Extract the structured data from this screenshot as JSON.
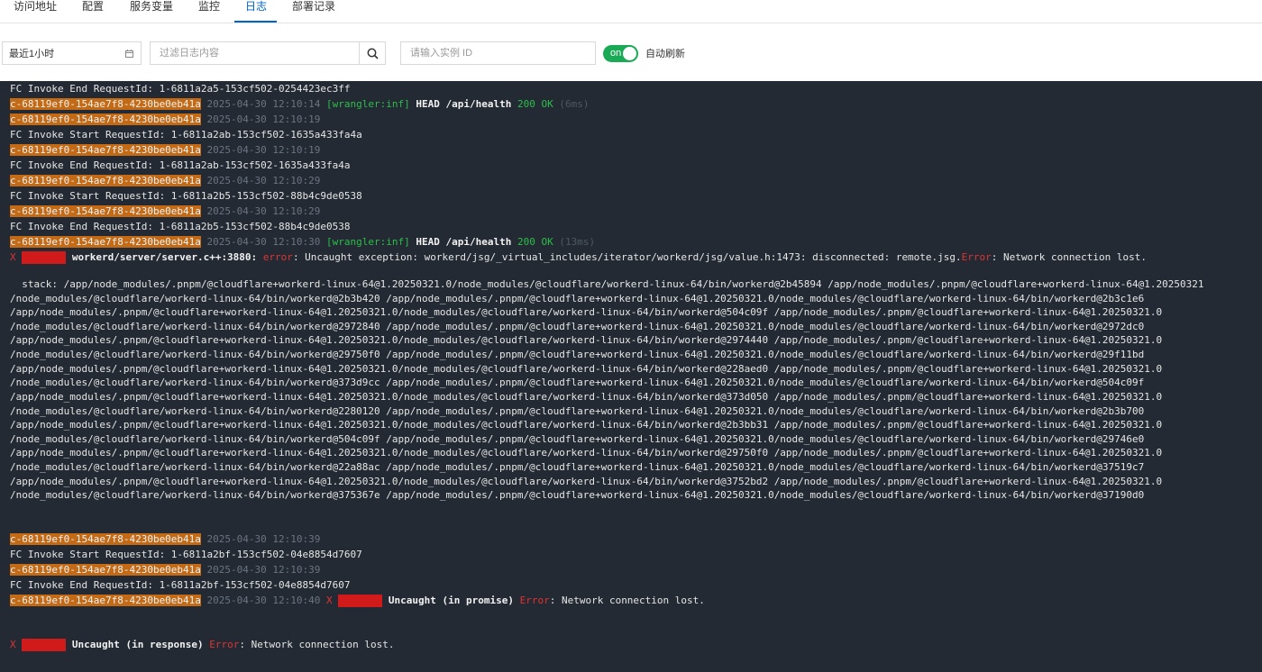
{
  "tabs": [
    {
      "label": "访问地址"
    },
    {
      "label": "配置"
    },
    {
      "label": "服务变量"
    },
    {
      "label": "监控"
    },
    {
      "label": "日志",
      "active": true
    },
    {
      "label": "部署记录"
    }
  ],
  "toolbar": {
    "time_range": "最近1小时",
    "filter_placeholder": "过滤日志内容",
    "instance_placeholder": "请输入实例 ID",
    "auto_refresh_toggle": "on",
    "auto_refresh_label": "自动刷新"
  },
  "colors": {
    "accent": "#0064c8",
    "toggle_on": "#1aaa55",
    "log_bg": "#232a33",
    "instance_highlight": "#c26a16",
    "error": "#e03333"
  },
  "log": {
    "instance_id": "c-68119ef0-154ae7f8-4230be0eb41a",
    "x_mark": "X",
    "entries": {
      "l0": "FC Invoke End RequestId: 1-6811a2a5-153cf502-0254423ec3ff",
      "l1": {
        "ts": "2025-04-30 12:10:14",
        "tag": "[wrangler:inf]",
        "req": "HEAD /api/health",
        "status": "200 OK",
        "dur": "(6ms)"
      },
      "l2": {
        "ts": "2025-04-30 12:10:19"
      },
      "l3": "FC Invoke Start RequestId: 1-6811a2ab-153cf502-1635a433fa4a",
      "l4": {
        "ts": "2025-04-30 12:10:19"
      },
      "l5": "FC Invoke End RequestId: 1-6811a2ab-153cf502-1635a433fa4a",
      "l6": {
        "ts": "2025-04-30 12:10:29"
      },
      "l7": "FC Invoke Start RequestId: 1-6811a2b5-153cf502-88b4c9de0538",
      "l8": {
        "ts": "2025-04-30 12:10:29"
      },
      "l9": "FC Invoke End RequestId: 1-6811a2b5-153cf502-88b4c9de0538",
      "l10": {
        "ts": "2025-04-30 12:10:30",
        "tag": "[wrangler:inf]",
        "req": "HEAD /api/health",
        "status": "200 OK",
        "dur": "(13ms)"
      },
      "l11": {
        "source": "workerd/server/server.c++:3880:",
        "err_word": "error",
        "msg1": ": Uncaught exception: workerd/jsg/_virtual_includes/iterator/workerd/jsg/value.h:1473: disconnected: remote.jsg.",
        "err_word2": "Error",
        "msg2": ": Network connection lost."
      },
      "stack": [
        "  stack: /app/node_modules/.pnpm/@cloudflare+workerd-linux-64@1.20250321.0/node_modules/@cloudflare/workerd-linux-64/bin/workerd@2b45894 /app/node_modules/.pnpm/@cloudflare+workerd-linux-64@1.20250321",
        "/node_modules/@cloudflare/workerd-linux-64/bin/workerd@2b3b420 /app/node_modules/.pnpm/@cloudflare+workerd-linux-64@1.20250321.0/node_modules/@cloudflare/workerd-linux-64/bin/workerd@2b3c1e6",
        "/app/node_modules/.pnpm/@cloudflare+workerd-linux-64@1.20250321.0/node_modules/@cloudflare/workerd-linux-64/bin/workerd@504c09f /app/node_modules/.pnpm/@cloudflare+workerd-linux-64@1.20250321.0",
        "/node_modules/@cloudflare/workerd-linux-64/bin/workerd@2972840 /app/node_modules/.pnpm/@cloudflare+workerd-linux-64@1.20250321.0/node_modules/@cloudflare/workerd-linux-64/bin/workerd@2972dc0",
        "/app/node_modules/.pnpm/@cloudflare+workerd-linux-64@1.20250321.0/node_modules/@cloudflare/workerd-linux-64/bin/workerd@2974440 /app/node_modules/.pnpm/@cloudflare+workerd-linux-64@1.20250321.0",
        "/node_modules/@cloudflare/workerd-linux-64/bin/workerd@29750f0 /app/node_modules/.pnpm/@cloudflare+workerd-linux-64@1.20250321.0/node_modules/@cloudflare/workerd-linux-64/bin/workerd@29f11bd",
        "/app/node_modules/.pnpm/@cloudflare+workerd-linux-64@1.20250321.0/node_modules/@cloudflare/workerd-linux-64/bin/workerd@228aed0 /app/node_modules/.pnpm/@cloudflare+workerd-linux-64@1.20250321.0",
        "/node_modules/@cloudflare/workerd-linux-64/bin/workerd@373d9cc /app/node_modules/.pnpm/@cloudflare+workerd-linux-64@1.20250321.0/node_modules/@cloudflare/workerd-linux-64/bin/workerd@504c09f",
        "/app/node_modules/.pnpm/@cloudflare+workerd-linux-64@1.20250321.0/node_modules/@cloudflare/workerd-linux-64/bin/workerd@373d050 /app/node_modules/.pnpm/@cloudflare+workerd-linux-64@1.20250321.0",
        "/node_modules/@cloudflare/workerd-linux-64/bin/workerd@2280120 /app/node_modules/.pnpm/@cloudflare+workerd-linux-64@1.20250321.0/node_modules/@cloudflare/workerd-linux-64/bin/workerd@2b3b700",
        "/app/node_modules/.pnpm/@cloudflare+workerd-linux-64@1.20250321.0/node_modules/@cloudflare/workerd-linux-64/bin/workerd@2b3bb31 /app/node_modules/.pnpm/@cloudflare+workerd-linux-64@1.20250321.0",
        "/node_modules/@cloudflare/workerd-linux-64/bin/workerd@504c09f /app/node_modules/.pnpm/@cloudflare+workerd-linux-64@1.20250321.0/node_modules/@cloudflare/workerd-linux-64/bin/workerd@29746e0",
        "/app/node_modules/.pnpm/@cloudflare+workerd-linux-64@1.20250321.0/node_modules/@cloudflare/workerd-linux-64/bin/workerd@29750f0 /app/node_modules/.pnpm/@cloudflare+workerd-linux-64@1.20250321.0",
        "/node_modules/@cloudflare/workerd-linux-64/bin/workerd@22a88ac /app/node_modules/.pnpm/@cloudflare+workerd-linux-64@1.20250321.0/node_modules/@cloudflare/workerd-linux-64/bin/workerd@37519c7",
        "/app/node_modules/.pnpm/@cloudflare+workerd-linux-64@1.20250321.0/node_modules/@cloudflare/workerd-linux-64/bin/workerd@3752bd2 /app/node_modules/.pnpm/@cloudflare+workerd-linux-64@1.20250321.0",
        "/node_modules/@cloudflare/workerd-linux-64/bin/workerd@375367e /app/node_modules/.pnpm/@cloudflare+workerd-linux-64@1.20250321.0/node_modules/@cloudflare/workerd-linux-64/bin/workerd@37190d0"
      ],
      "l12": {
        "ts": "2025-04-30 12:10:39"
      },
      "l13": "FC Invoke Start RequestId: 1-6811a2bf-153cf502-04e8854d7607",
      "l14": {
        "ts": "2025-04-30 12:10:39"
      },
      "l15": "FC Invoke End RequestId: 1-6811a2bf-153cf502-04e8854d7607",
      "l16": {
        "ts": "2025-04-30 12:10:40",
        "bold": "Uncaught (in promise)",
        "err_word": "Error",
        "msg": ": Network connection lost."
      },
      "l17": {
        "bold": "Uncaught (in response)",
        "err_word": "Error",
        "msg": ": Network connection lost."
      }
    }
  }
}
